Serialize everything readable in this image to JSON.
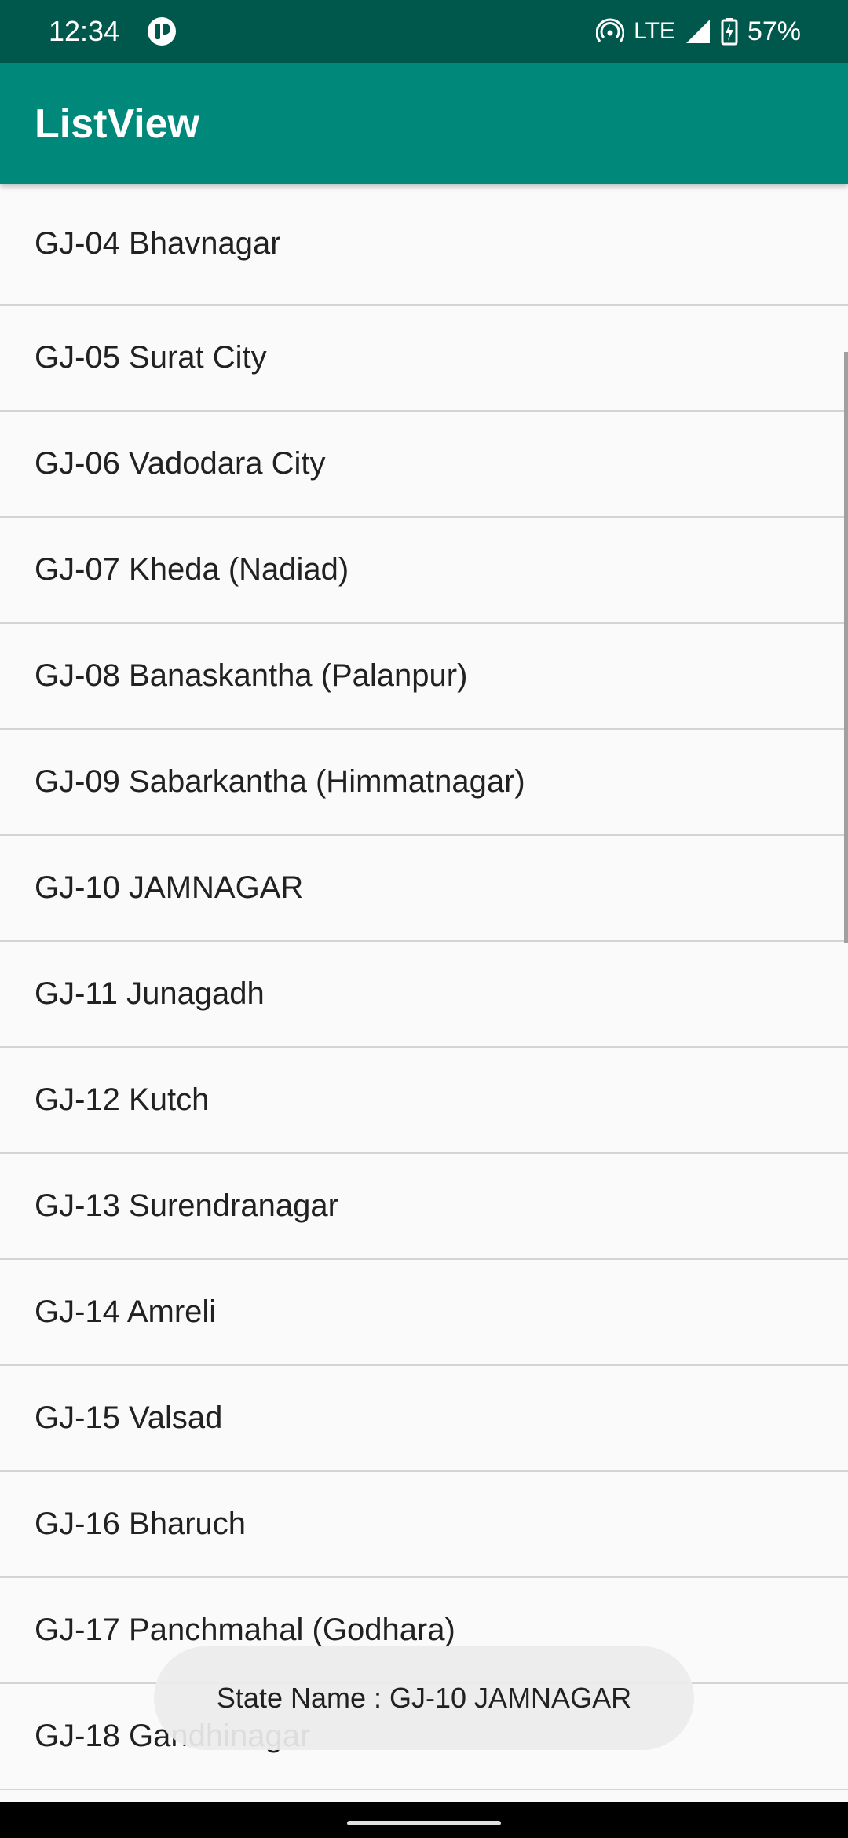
{
  "status_bar": {
    "time": "12:34",
    "network": "LTE",
    "battery": "57%",
    "icons": [
      "app-notification-icon",
      "hotspot-icon",
      "signal-icon",
      "battery-charging-icon"
    ]
  },
  "app_bar": {
    "title": "ListView"
  },
  "list": {
    "items": [
      "GJ-04 Bhavnagar",
      "GJ-05 Surat City",
      "GJ-06 Vadodara City",
      "GJ-07 Kheda (Nadiad)",
      "GJ-08 Banaskantha (Palanpur)",
      "GJ-09 Sabarkantha (Himmatnagar)",
      "GJ-10 JAMNAGAR",
      "GJ-11 Junagadh",
      "GJ-12 Kutch",
      "GJ-13 Surendranagar",
      "GJ-14 Amreli",
      "GJ-15 Valsad",
      "GJ-16 Bharuch",
      "GJ-17 Panchmahal (Godhara)",
      "GJ-18 Gandhinagar"
    ]
  },
  "toast": {
    "message": "State Name : GJ-10 JAMNAGAR"
  },
  "colors": {
    "status_bar": "#00574b",
    "app_bar": "#00897b",
    "background": "#fafafa"
  }
}
